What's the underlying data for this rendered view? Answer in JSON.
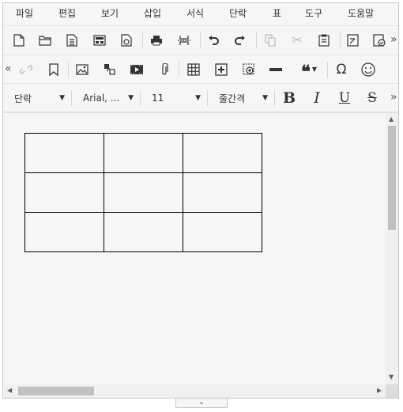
{
  "menubar": {
    "items": [
      "파일",
      "편집",
      "보기",
      "삽입",
      "서식",
      "단락",
      "표",
      "도구",
      "도움말"
    ]
  },
  "toolbar": {
    "paragraph_select": "단락",
    "font_select": "Arial, ...",
    "size_select": "11",
    "line_height_select": "줄간격",
    "bold_label": "B",
    "italic_label": "I",
    "underline_label": "U",
    "strike_label": "S",
    "more_label": "»",
    "less_label": "«"
  },
  "table": {
    "rows": 3,
    "cols": 3
  },
  "resize_handle": "⌄"
}
